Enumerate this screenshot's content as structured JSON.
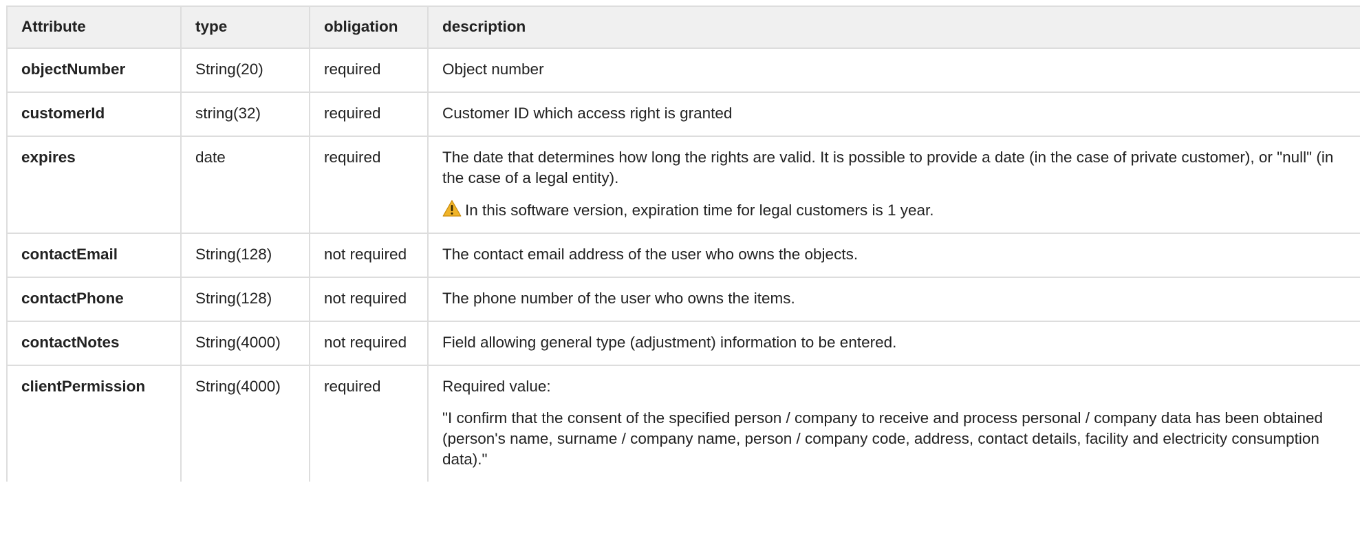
{
  "table": {
    "headers": [
      "Attribute",
      "type",
      "obligation",
      "description"
    ],
    "rows": [
      {
        "attribute": "objectNumber",
        "type": "String(20)",
        "obligation": "required",
        "description": "Object number"
      },
      {
        "attribute": "customerId",
        "type": "string(32)",
        "obligation": "required",
        "description": "Customer ID which access right is granted"
      },
      {
        "attribute": "expires",
        "type": "date",
        "obligation": "required",
        "description": "The date that determines how long the rights are valid. It is possible to provide a date (in the case of private customer), or \"null\" (in the case of a legal entity).",
        "note": "In this software version, expiration time for legal customers is 1 year.",
        "note_icon": "warning-icon"
      },
      {
        "attribute": "contactEmail",
        "type": "String(128)",
        "obligation": "not required",
        "description": "The contact email address of the user who owns the objects."
      },
      {
        "attribute": "contactPhone",
        "type": "String(128)",
        "obligation": "not required",
        "description": "The phone number of the user who owns the items."
      },
      {
        "attribute": "contactNotes",
        "type": "String(4000)",
        "obligation": "not required",
        "description": "Field allowing general type (adjustment) information to be entered."
      },
      {
        "attribute": "clientPermission",
        "type": "String(4000)",
        "obligation": "required",
        "description": "Required value:",
        "description_2": "\"I confirm that the consent of the specified person / company to receive and process personal / company data has been obtained (person's name, surname / company name, person / company code, address, contact details, facility and electricity consumption data).\""
      }
    ]
  },
  "colors": {
    "header_bg": "#f0f0f0",
    "border": "#dddddd",
    "text": "#222222",
    "warning": "#f0b429"
  }
}
